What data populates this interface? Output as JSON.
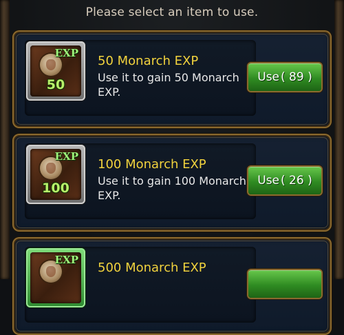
{
  "header": {
    "prompt": "Please select an item to use."
  },
  "items": [
    {
      "icon": "exp-book-icon",
      "tier_color": "#bcbcbc",
      "exp_tag": "EXP",
      "level": "50",
      "title": "50 Monarch EXP",
      "description": "Use it to gain 50 Monarch EXP.",
      "button_label": "Use",
      "count_text": "( 89 )"
    },
    {
      "icon": "exp-book-icon",
      "tier_color": "#bcbcbc",
      "exp_tag": "EXP",
      "level": "100",
      "title": "100 Monarch EXP",
      "description": "Use it to gain 100 Monarch EXP.",
      "button_label": "Use",
      "count_text": "( 26 )"
    },
    {
      "icon": "exp-book-icon",
      "tier_color": "#5fcf56",
      "exp_tag": "EXP",
      "level": "",
      "title": "500 Monarch EXP",
      "description": "",
      "button_label": "",
      "count_text": ""
    }
  ],
  "colors": {
    "title_gold": "#f1d23d",
    "button_green": "#2f8b22",
    "frame_gold": "#8c6a2e"
  }
}
